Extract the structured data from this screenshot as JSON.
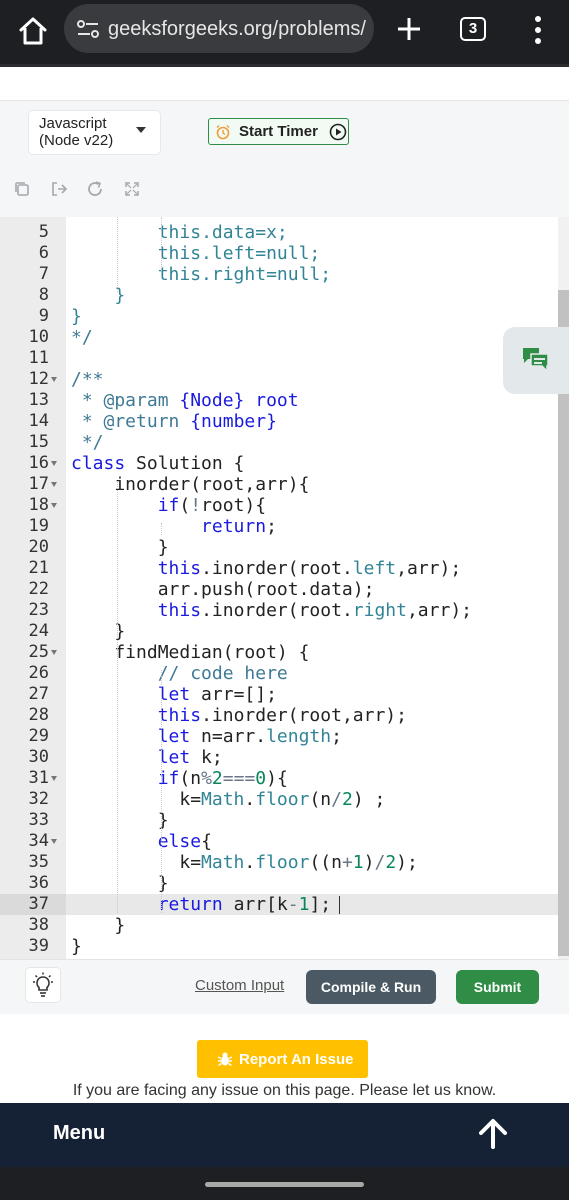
{
  "browser": {
    "url": "geeksforgeeks.org/problems/me",
    "tab_count": "3"
  },
  "ide": {
    "language": "Javascript\n(Node v22)",
    "timer_label": "Start Timer"
  },
  "code": {
    "active_line": 37,
    "lines": [
      {
        "n": "5",
        "fold": false,
        "tokens": [
          [
            "this",
            "prop"
          ],
          [
            ".data=x;",
            "prop"
          ]
        ]
      },
      {
        "n": "6",
        "fold": false,
        "tokens": [
          [
            "this.left=null;",
            "prop"
          ]
        ]
      },
      {
        "n": "7",
        "fold": false,
        "tokens": [
          [
            "this.right=null;",
            "prop"
          ]
        ]
      },
      {
        "n": "8",
        "fold": false,
        "tokens": [
          [
            "}",
            "prop"
          ]
        ]
      },
      {
        "n": "9",
        "fold": false,
        "tokens": [
          [
            "}",
            "prop"
          ]
        ]
      },
      {
        "n": "10",
        "fold": false,
        "tokens": [
          [
            "*/",
            "cm"
          ]
        ]
      },
      {
        "n": "11",
        "fold": false,
        "tokens": []
      },
      {
        "n": "12",
        "fold": true,
        "tokens": [
          [
            "/**",
            "cm"
          ]
        ]
      },
      {
        "n": "13",
        "fold": false,
        "tokens": [
          [
            " * @param ",
            "cm"
          ],
          [
            "{Node} root",
            "kw"
          ]
        ]
      },
      {
        "n": "14",
        "fold": false,
        "tokens": [
          [
            " * @return ",
            "cm"
          ],
          [
            "{number}",
            "kw"
          ]
        ]
      },
      {
        "n": "15",
        "fold": false,
        "tokens": [
          [
            " */",
            "cm"
          ]
        ]
      },
      {
        "n": "16",
        "fold": true,
        "tokens": [
          [
            "class",
            "kw"
          ],
          [
            " Solution {",
            ""
          ]
        ]
      },
      {
        "n": "17",
        "fold": true,
        "tokens": [
          [
            "    inorder(root,arr){",
            ""
          ]
        ]
      },
      {
        "n": "18",
        "fold": true,
        "tokens": [
          [
            "        ",
            ""
          ],
          [
            "if",
            "kw"
          ],
          [
            "(",
            ""
          ],
          [
            "!",
            "op"
          ],
          [
            "root){",
            ""
          ]
        ]
      },
      {
        "n": "19",
        "fold": false,
        "tokens": [
          [
            "            ",
            ""
          ],
          [
            "return",
            "kw"
          ],
          [
            ";",
            ""
          ]
        ]
      },
      {
        "n": "20",
        "fold": false,
        "tokens": [
          [
            "        }",
            ""
          ]
        ]
      },
      {
        "n": "21",
        "fold": false,
        "tokens": [
          [
            "        ",
            ""
          ],
          [
            "this",
            "kw"
          ],
          [
            ".inorder(root.",
            ""
          ],
          [
            "left",
            "prop"
          ],
          [
            ",arr);",
            ""
          ]
        ]
      },
      {
        "n": "22",
        "fold": false,
        "tokens": [
          [
            "        arr.push(root.data);",
            ""
          ]
        ]
      },
      {
        "n": "23",
        "fold": false,
        "tokens": [
          [
            "        ",
            ""
          ],
          [
            "this",
            "kw"
          ],
          [
            ".inorder(root.",
            ""
          ],
          [
            "right",
            "prop"
          ],
          [
            ",arr);",
            ""
          ]
        ]
      },
      {
        "n": "24",
        "fold": false,
        "tokens": [
          [
            "    }",
            ""
          ]
        ]
      },
      {
        "n": "25",
        "fold": true,
        "tokens": [
          [
            "    findMedian(root) {",
            ""
          ]
        ]
      },
      {
        "n": "26",
        "fold": false,
        "tokens": [
          [
            "        // code here",
            "cm"
          ]
        ]
      },
      {
        "n": "27",
        "fold": false,
        "tokens": [
          [
            "        ",
            ""
          ],
          [
            "let",
            "kw"
          ],
          [
            " arr=[];",
            ""
          ]
        ]
      },
      {
        "n": "28",
        "fold": false,
        "tokens": [
          [
            "        ",
            ""
          ],
          [
            "this",
            "kw"
          ],
          [
            ".inorder(root,arr);",
            ""
          ]
        ]
      },
      {
        "n": "29",
        "fold": false,
        "tokens": [
          [
            "        ",
            ""
          ],
          [
            "let",
            "kw"
          ],
          [
            " n=arr.",
            ""
          ],
          [
            "length",
            "prop"
          ],
          [
            ";",
            ""
          ]
        ]
      },
      {
        "n": "30",
        "fold": false,
        "tokens": [
          [
            "        ",
            ""
          ],
          [
            "let",
            "kw"
          ],
          [
            " k;",
            ""
          ]
        ]
      },
      {
        "n": "31",
        "fold": true,
        "tokens": [
          [
            "        ",
            ""
          ],
          [
            "if",
            "kw"
          ],
          [
            "(n",
            ""
          ],
          [
            "%",
            "op"
          ],
          [
            "2",
            "num"
          ],
          [
            "===",
            "op"
          ],
          [
            "0",
            "num"
          ],
          [
            "){",
            ""
          ]
        ]
      },
      {
        "n": "32",
        "fold": false,
        "tokens": [
          [
            "          k=",
            ""
          ],
          [
            "Math",
            "prop"
          ],
          [
            ".",
            ""
          ],
          [
            "floor",
            "prop"
          ],
          [
            "(n",
            ""
          ],
          [
            "/",
            "op"
          ],
          [
            "2",
            "num"
          ],
          [
            ") ;",
            ""
          ]
        ]
      },
      {
        "n": "33",
        "fold": false,
        "tokens": [
          [
            "        }",
            ""
          ]
        ]
      },
      {
        "n": "34",
        "fold": true,
        "tokens": [
          [
            "        ",
            ""
          ],
          [
            "else",
            "kw"
          ],
          [
            "{",
            ""
          ]
        ]
      },
      {
        "n": "35",
        "fold": false,
        "tokens": [
          [
            "          k=",
            ""
          ],
          [
            "Math",
            "prop"
          ],
          [
            ".",
            ""
          ],
          [
            "floor",
            "prop"
          ],
          [
            "((n",
            ""
          ],
          [
            "+",
            "op"
          ],
          [
            "1",
            "num"
          ],
          [
            ")",
            ""
          ],
          [
            "/",
            "op"
          ],
          [
            "2",
            "num"
          ],
          [
            ");",
            ""
          ]
        ]
      },
      {
        "n": "36",
        "fold": false,
        "tokens": [
          [
            "        }",
            ""
          ]
        ]
      },
      {
        "n": "37",
        "fold": false,
        "tokens": [
          [
            "        ",
            ""
          ],
          [
            "return",
            "kw"
          ],
          [
            " arr[k",
            ""
          ],
          [
            "-",
            "op"
          ],
          [
            "1",
            "num"
          ],
          [
            "];",
            ""
          ]
        ]
      },
      {
        "n": "38",
        "fold": false,
        "tokens": [
          [
            "    }",
            ""
          ]
        ]
      },
      {
        "n": "39",
        "fold": false,
        "tokens": [
          [
            "}",
            ""
          ]
        ]
      }
    ]
  },
  "actions": {
    "custom_input": "Custom Input",
    "compile_run": "Compile & Run",
    "submit": "Submit"
  },
  "report": {
    "button": "Report An Issue",
    "note": "If you are facing any issue on this page. Please let us know."
  },
  "footer": {
    "menu": "Menu"
  },
  "colors": {
    "brand_green": "#2f8d46",
    "menu_bg": "#152235",
    "report_yellow": "#ffc000",
    "keyword": "#1a1ae0",
    "comment": "#3f7a95",
    "property": "#318495",
    "number": "#098658"
  },
  "icons": [
    "home-icon",
    "site-settings-icon",
    "new-tab-icon",
    "tab-switcher-icon",
    "more-vert-icon",
    "alarm-icon",
    "play-icon",
    "copy-icon",
    "exit-icon",
    "reset-icon",
    "fullscreen-icon",
    "chat-icon",
    "lightbulb-icon",
    "bug-icon",
    "arrow-up-icon"
  ]
}
